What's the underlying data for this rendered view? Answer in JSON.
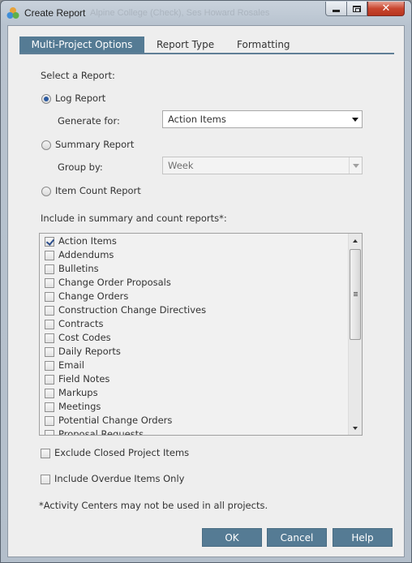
{
  "window": {
    "title": "Create Report",
    "title_ghost": "Alpine College (Check), Ses     Howard Rosales"
  },
  "tabs": [
    {
      "label": "Multi-Project Options",
      "active": true
    },
    {
      "label": "Report Type",
      "active": false
    },
    {
      "label": "Formatting",
      "active": false
    }
  ],
  "form": {
    "select_report_label": "Select a Report:",
    "log_report_label": "Log Report",
    "log_report_selected": true,
    "generate_for_label": "Generate for:",
    "generate_for_value": "Action Items",
    "summary_report_label": "Summary Report",
    "group_by_label": "Group by:",
    "group_by_value": "Week",
    "item_count_label": "Item Count Report",
    "include_label": "Include in summary and count reports*:"
  },
  "list": {
    "items": [
      {
        "label": "Action Items",
        "checked": true
      },
      {
        "label": "Addendums",
        "checked": false
      },
      {
        "label": "Bulletins",
        "checked": false
      },
      {
        "label": "Change Order Proposals",
        "checked": false
      },
      {
        "label": "Change Orders",
        "checked": false
      },
      {
        "label": "Construction Change Directives",
        "checked": false
      },
      {
        "label": "Contracts",
        "checked": false
      },
      {
        "label": "Cost Codes",
        "checked": false
      },
      {
        "label": "Daily Reports",
        "checked": false
      },
      {
        "label": "Email",
        "checked": false
      },
      {
        "label": "Field Notes",
        "checked": false
      },
      {
        "label": "Markups",
        "checked": false
      },
      {
        "label": "Meetings",
        "checked": false
      },
      {
        "label": "Potential Change Orders",
        "checked": false
      },
      {
        "label": "Proposal Requests",
        "checked": false
      }
    ]
  },
  "options": {
    "exclude_closed_label": "Exclude Closed Project Items",
    "overdue_only_label": "Include Overdue Items Only",
    "footnote": "*Activity Centers may not be used in all projects."
  },
  "buttons": {
    "ok": "OK",
    "cancel": "Cancel",
    "help": "Help"
  },
  "colors": {
    "accent": "#557b94",
    "close_button": "#c8462f"
  }
}
